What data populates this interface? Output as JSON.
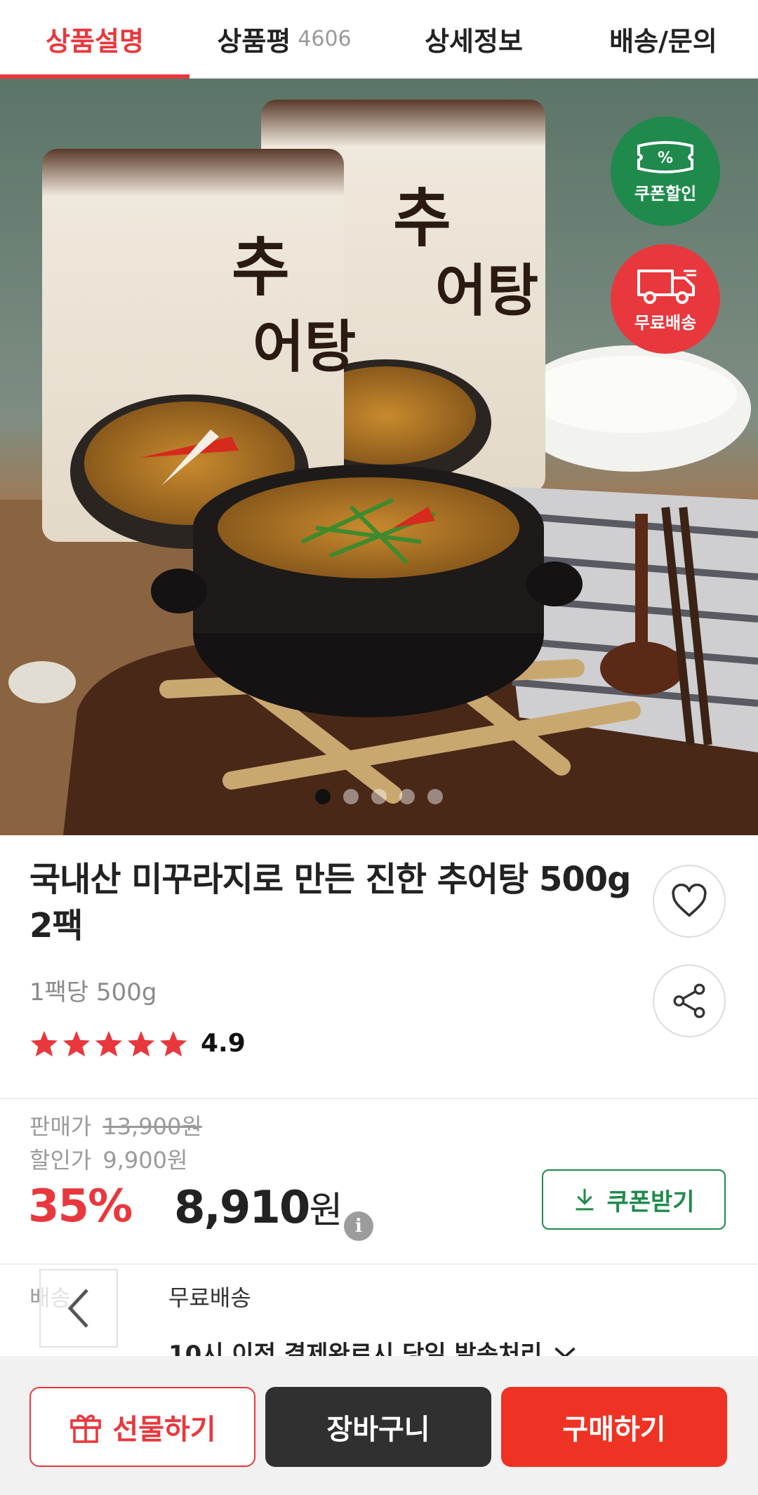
{
  "tabs": [
    {
      "label": "상품설명",
      "count": ""
    },
    {
      "label": "상품평",
      "count": "4606"
    },
    {
      "label": "상세정보",
      "count": ""
    },
    {
      "label": "배송/문의",
      "count": ""
    }
  ],
  "hero": {
    "badges": {
      "coupon_label": "쿠폰할인",
      "coupon_symbol": "%",
      "shipping_label": "무료배송"
    },
    "pagination": {
      "current": 1,
      "total": 5
    }
  },
  "product": {
    "title": "국내산 미꾸라지로 만든 진한 추어탕 500g 2팩",
    "subtitle": "1팩당 500g",
    "rating": "4.9",
    "stars": 5
  },
  "price": {
    "original_label": "판매가",
    "original_value": "13,900원",
    "discount_label": "할인가",
    "discount_value": "9,900원",
    "percent": "35%",
    "final_amount": "8,910",
    "final_unit": "원",
    "info_symbol": "i",
    "coupon_button": "쿠폰받기"
  },
  "delivery": {
    "label": "배송",
    "value": "무료배송",
    "time_note": "10시 이전 결제완료시 당일 발송처리"
  },
  "bottom_bar": {
    "gift": "선물하기",
    "cart": "장바구니",
    "buy": "구매하기"
  },
  "colors": {
    "accent": "#e8383d",
    "green": "#1f8a4c",
    "dark": "#303030",
    "buy": "#ee3224"
  }
}
